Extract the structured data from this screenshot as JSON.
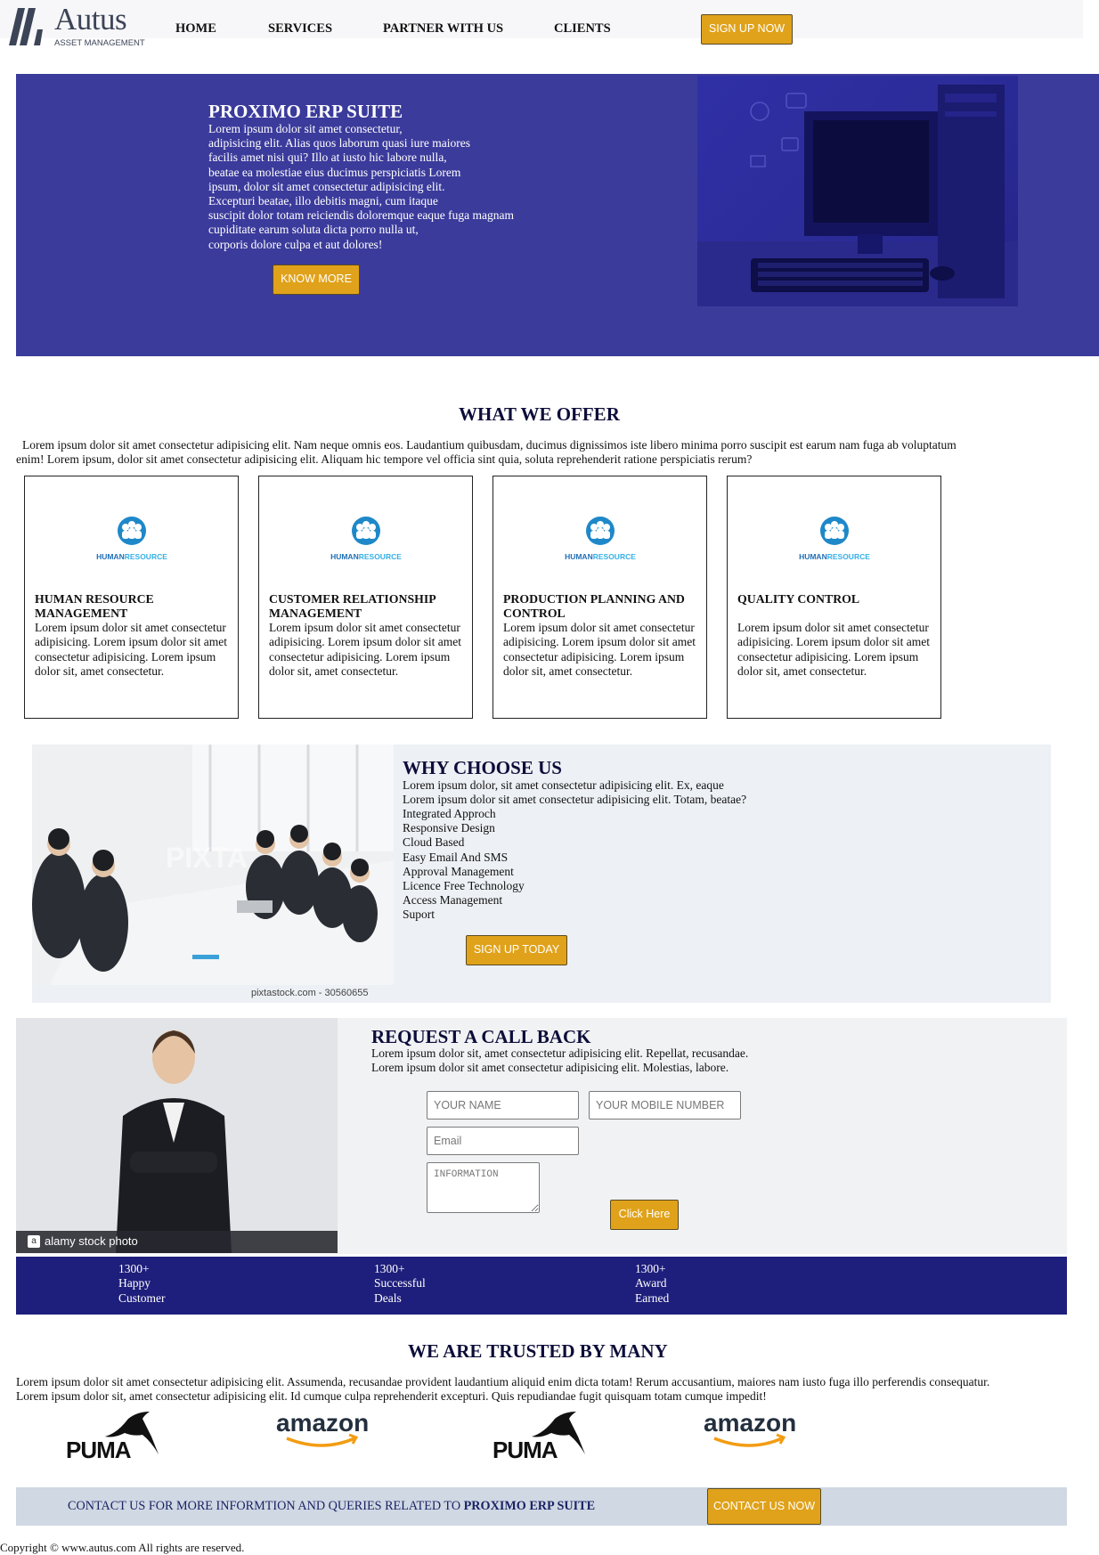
{
  "header": {
    "logo_name": "Autus",
    "logo_sub": "ASSET MANAGEMENT",
    "nav": [
      "HOME",
      "SERVICES",
      "PARTNER WITH US",
      "CLIENTS"
    ],
    "signup_label": "SIGN UP NOW"
  },
  "hero": {
    "title": "PROXIMO ERP SUITE",
    "lines": [
      "Lorem ipsum dolor sit amet consectetur,",
      "adipisicing elit. Alias quos laborum quasi iure maiores",
      "facilis amet nisi qui? Illo at iusto hic labore nulla,",
      "beatae ea molestiae eius ducimus perspiciatis Lorem",
      "ipsum, dolor sit amet consectetur adipisicing elit.",
      "Excepturi beatae, illo debitis magni, cum itaque",
      "suscipit dolor totam reiciendis doloremque eaque fuga magnam",
      "cupiditate earum soluta dicta porro nulla ut,",
      "corporis dolore culpa et aut dolores!"
    ],
    "button_label": "KNOW MORE"
  },
  "offer": {
    "title": "WHAT WE OFFER",
    "text": "Lorem ipsum dolor sit amet consectetur adipisicing elit. Nam neque omnis eos. Laudantium quibusdam, ducimus dignissimos iste libero minima porro suscipit est earum nam fuga ab voluptatum enim! Lorem ipsum, dolor sit amet consectetur adipisicing elit. Aliquam hic tempore vel officia sint quia, soluta reprehenderit ratione perspiciatis rerum?",
    "card_logo_text_a": "HUMAN",
    "card_logo_text_b": "RESOURCE",
    "cards": [
      {
        "title": "HUMAN RESOURCE MANAGEMENT",
        "text": "Lorem ipsum dolor sit amet consectetur adipisicing. Lorem ipsum dolor sit amet consectetur adipisicing. Lorem ipsum dolor sit, amet consectetur."
      },
      {
        "title": "CUSTOMER RELATIONSHIP MANAGEMENT",
        "text": "Lorem ipsum dolor sit amet consectetur adipisicing. Lorem ipsum dolor sit amet consectetur adipisicing. Lorem ipsum dolor sit, amet consectetur."
      },
      {
        "title": "PRODUCTION PLANNING AND CONTROL",
        "text": "Lorem ipsum dolor sit amet consectetur adipisicing. Lorem ipsum dolor sit amet consectetur adipisicing. Lorem ipsum dolor sit, amet consectetur."
      },
      {
        "title": "QUALITY CONTROL",
        "text": "Lorem ipsum dolor sit amet consectetur adipisicing. Lorem ipsum dolor sit amet consectetur adipisicing. Lorem ipsum dolor sit, amet consectetur."
      }
    ]
  },
  "why": {
    "title": "WHY CHOOSE US",
    "lines": [
      "Lorem ipsum dolor, sit amet consectetur adipisicing elit. Ex, eaque",
      "Lorem ipsum dolor sit amet consectetur adipisicing elit. Totam, beatae?"
    ],
    "features": [
      "Integrated Approch",
      "Responsive Design",
      "Cloud Based",
      "Easy Email And SMS",
      "Approval Management",
      "Licence Free Technology",
      "Access Management",
      "Suport"
    ],
    "image_credit": "pixtastock.com - 30560655",
    "image_watermark": "PIXTA",
    "button_label": "SIGN UP TODAY"
  },
  "callback": {
    "title": "REQUEST A CALL BACK",
    "lines": [
      "Lorem ipsum dolor sit, amet consectetur adipisicing elit. Repellat, recusandae.",
      "Lorem ipsum dolor sit amet consectetur adipisicing elit. Molestias, labore."
    ],
    "image_credit": "alamy stock photo",
    "name_placeholder": "YOUR NAME",
    "mobile_placeholder": "YOUR MOBILE NUMBER",
    "email_placeholder": "Email",
    "info_placeholder": "INFORMATION",
    "button_label": "Click Here"
  },
  "stats": [
    {
      "value": "1300+",
      "line1": "Happy",
      "line2": "Customer"
    },
    {
      "value": "1300+",
      "line1": "Successful",
      "line2": "Deals"
    },
    {
      "value": "1300+",
      "line1": "Award",
      "line2": "Earned"
    }
  ],
  "trusted": {
    "title": "WE ARE TRUSTED BY MANY",
    "lines": [
      "Lorem ipsum dolor sit amet consectetur adipisicing elit. Assumenda, recusandae provident laudantium aliquid enim dicta totam! Rerum accusantium, maiores nam iusto fuga illo perferendis consequatur.",
      "Lorem ipsum dolor sit, amet consectetur adipisicing elit. Id cumque culpa reprehenderit excepturi. Quis repudiandae fugit quisquam totam cumque impedit!"
    ],
    "brands": [
      "PUMA",
      "amazon",
      "PUMA",
      "amazon"
    ]
  },
  "contact": {
    "text": "CONTACT US FOR MORE INFORMTION AND QUERIES RELATED TO",
    "product": "PROXIMO ERP SUITE",
    "button_label": "CONTACT US NOW"
  },
  "footer": {
    "copyright": "Copyright © www.autus.com All rights are reserved."
  },
  "colors": {
    "hero_bg": "#3b3b9c",
    "accent": "#e0a21a",
    "stats_bg": "#1e1e7c",
    "contact_bg": "#cfd8e3"
  }
}
